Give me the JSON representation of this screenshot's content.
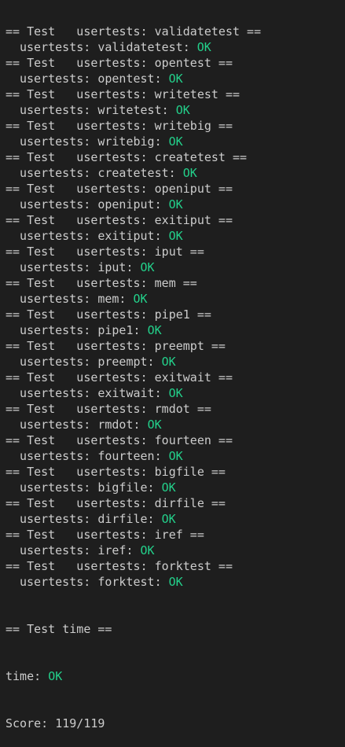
{
  "terminal": {
    "tests": [
      {
        "header": "== Test   usertests: validatetest ==",
        "result_prefix": "usertests: validatetest: ",
        "status": "OK"
      },
      {
        "header": "== Test   usertests: opentest ==",
        "result_prefix": "usertests: opentest: ",
        "status": "OK"
      },
      {
        "header": "== Test   usertests: writetest ==",
        "result_prefix": "usertests: writetest: ",
        "status": "OK"
      },
      {
        "header": "== Test   usertests: writebig ==",
        "result_prefix": "usertests: writebig: ",
        "status": "OK"
      },
      {
        "header": "== Test   usertests: createtest ==",
        "result_prefix": "usertests: createtest: ",
        "status": "OK"
      },
      {
        "header": "== Test   usertests: openiput ==",
        "result_prefix": "usertests: openiput: ",
        "status": "OK"
      },
      {
        "header": "== Test   usertests: exitiput ==",
        "result_prefix": "usertests: exitiput: ",
        "status": "OK"
      },
      {
        "header": "== Test   usertests: iput ==",
        "result_prefix": "usertests: iput: ",
        "status": "OK"
      },
      {
        "header": "== Test   usertests: mem ==",
        "result_prefix": "usertests: mem: ",
        "status": "OK"
      },
      {
        "header": "== Test   usertests: pipe1 ==",
        "result_prefix": "usertests: pipe1: ",
        "status": "OK"
      },
      {
        "header": "== Test   usertests: preempt ==",
        "result_prefix": "usertests: preempt: ",
        "status": "OK"
      },
      {
        "header": "== Test   usertests: exitwait ==",
        "result_prefix": "usertests: exitwait: ",
        "status": "OK"
      },
      {
        "header": "== Test   usertests: rmdot ==",
        "result_prefix": "usertests: rmdot: ",
        "status": "OK"
      },
      {
        "header": "== Test   usertests: fourteen ==",
        "result_prefix": "usertests: fourteen: ",
        "status": "OK"
      },
      {
        "header": "== Test   usertests: bigfile ==",
        "result_prefix": "usertests: bigfile: ",
        "status": "OK"
      },
      {
        "header": "== Test   usertests: dirfile ==",
        "result_prefix": "usertests: dirfile: ",
        "status": "OK"
      },
      {
        "header": "== Test   usertests: iref ==",
        "result_prefix": "usertests: iref: ",
        "status": "OK"
      },
      {
        "header": "== Test   usertests: forktest ==",
        "result_prefix": "usertests: forktest: ",
        "status": "OK"
      }
    ],
    "time_header": "== Test time ==",
    "time_prefix": "time: ",
    "time_status": "OK",
    "score": "Score: 119/119"
  },
  "colors": {
    "background": "#1e1e1e",
    "text": "#cccccc",
    "ok": "#23d18b"
  }
}
